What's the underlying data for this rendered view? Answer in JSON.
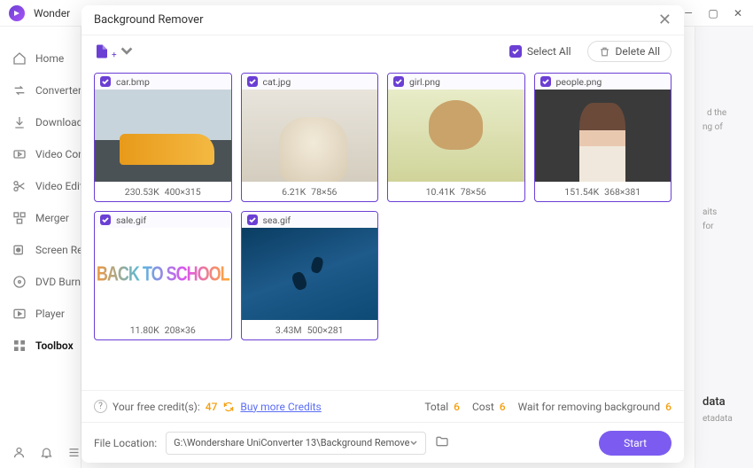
{
  "app": {
    "title": "Wonder"
  },
  "windowControls": {
    "min": "—",
    "max": "▢",
    "close": "✕"
  },
  "sidebar": {
    "items": [
      {
        "label": "Home",
        "icon": "home"
      },
      {
        "label": "Converter",
        "icon": "converter"
      },
      {
        "label": "Downloader",
        "icon": "download"
      },
      {
        "label": "Video Compressor",
        "icon": "videoco"
      },
      {
        "label": "Video Editor",
        "icon": "scissors"
      },
      {
        "label": "Merger",
        "icon": "merger"
      },
      {
        "label": "Screen Recorder",
        "icon": "record"
      },
      {
        "label": "DVD Burner",
        "icon": "dvd"
      },
      {
        "label": "Player",
        "icon": "player"
      },
      {
        "label": "Toolbox",
        "icon": "toolbox"
      }
    ]
  },
  "rightPanel": {
    "text1": "  d the",
    "text2": "ng of",
    "text3": "aits",
    "text4": "for",
    "text5": "data",
    "text6": "etadata"
  },
  "modal": {
    "title": "Background Remover",
    "selectAll": "Select All",
    "deleteAll": "Delete All",
    "files": [
      {
        "name": "car.bmp",
        "size": "230.53K",
        "dim": "400×315",
        "thumb": "car"
      },
      {
        "name": "cat.jpg",
        "size": "6.21K",
        "dim": "78×56",
        "thumb": "cat"
      },
      {
        "name": "girl.png",
        "size": "10.41K",
        "dim": "78×56",
        "thumb": "girl"
      },
      {
        "name": "people.png",
        "size": "151.54K",
        "dim": "368×381",
        "thumb": "people"
      },
      {
        "name": "sale.gif",
        "size": "11.80K",
        "dim": "208×36",
        "thumb": "sale"
      },
      {
        "name": "sea.gif",
        "size": "3.43M",
        "dim": "500×281",
        "thumb": "sea"
      }
    ],
    "credits": {
      "label": "Your free credit(s):",
      "count": "47",
      "buyMore": "Buy more Credits",
      "totalLabel": "Total",
      "total": "6",
      "costLabel": "Cost",
      "cost": "6",
      "waitLabel": "Wait for removing background",
      "wait": "6"
    },
    "location": {
      "label": "File Location:",
      "path": "G:\\Wondershare UniConverter 13\\Background Remove"
    },
    "start": "Start"
  }
}
